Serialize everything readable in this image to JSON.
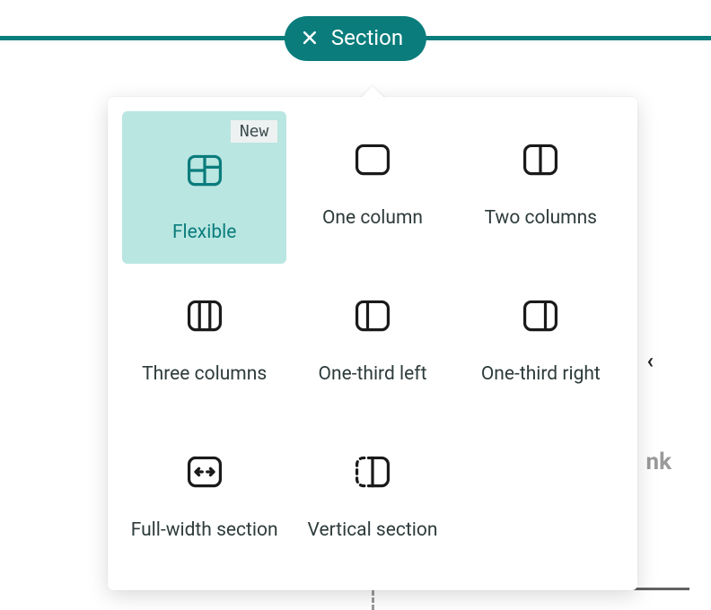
{
  "pill": {
    "label": "Section"
  },
  "badge": {
    "new": "New"
  },
  "options": {
    "flexible": "Flexible",
    "one_column": "One column",
    "two_columns": "Two columns",
    "three_columns": "Three columns",
    "one_third_left": "One-third left",
    "one_third_right": "One-third right",
    "full_width": "Full-width section",
    "vertical": "Vertical section"
  },
  "bg": {
    "k": "‹",
    "nk": "nk"
  }
}
